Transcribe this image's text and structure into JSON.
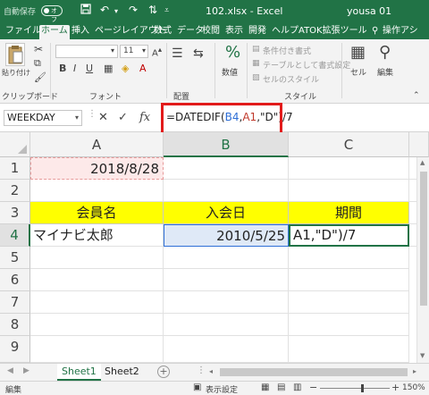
{
  "titlebar": {
    "autosave_label": "自動保存",
    "autosave_state": "オフ",
    "document": "102.xlsx  -  Excel",
    "user": "yousa 01"
  },
  "ribbon_tabs": [
    "ファイル",
    "ホーム",
    "挿入",
    "ページレイアウト",
    "数式",
    "データ",
    "校閲",
    "表示",
    "開発",
    "ヘルプ",
    "ATOK拡張ツール"
  ],
  "ribbon_tabs_active": "ホーム",
  "ribbon_extra": {
    "search_hint": "操作アシ"
  },
  "ribbon": {
    "paste_label": "貼り付け",
    "clipboard_group": "クリップボード",
    "font_group": "フォント",
    "font_size": "11",
    "alignment_group": "配置",
    "number_label": "数値",
    "conditional_format": "条件付き書式",
    "table_format": "テーブルとして書式設定",
    "cell_styles": "セルのスタイル",
    "styles_group": "スタイル",
    "cells_label": "セル",
    "edit_label": "編集"
  },
  "formula_bar": {
    "name_box": "WEEKDAY",
    "fx": "fx",
    "formula_prefix": "=DATEDIF(",
    "ref1": "B4",
    "comma1": ",",
    "ref2": "A1",
    "formula_suffix": ",\"D\")/7"
  },
  "columns": [
    "A",
    "B",
    "C"
  ],
  "rows": [
    "1",
    "2",
    "3",
    "4",
    "5",
    "6",
    "7",
    "8",
    "9"
  ],
  "cells": {
    "A1": "2018/8/28",
    "A3": "会員名",
    "B3": "入会日",
    "C3": "期間",
    "A4": "マイナビ太郎",
    "B4": "2010/5/25",
    "C4": "A1,\"D\")/7"
  },
  "sheets": [
    "Sheet1",
    "Sheet2"
  ],
  "sheets_active": "Sheet1",
  "status": {
    "mode": "編集",
    "display_settings": "表示設定",
    "zoom": "150%"
  },
  "colors": {
    "excel_green": "#217346",
    "header_yellow": "#ffff00",
    "a1_fill": "#fde9e9",
    "b4_fill": "#dfe9f7",
    "ref_blue": "#2f6fd6",
    "ref_red": "#c0392b",
    "highlight_red": "#e21b1b"
  }
}
